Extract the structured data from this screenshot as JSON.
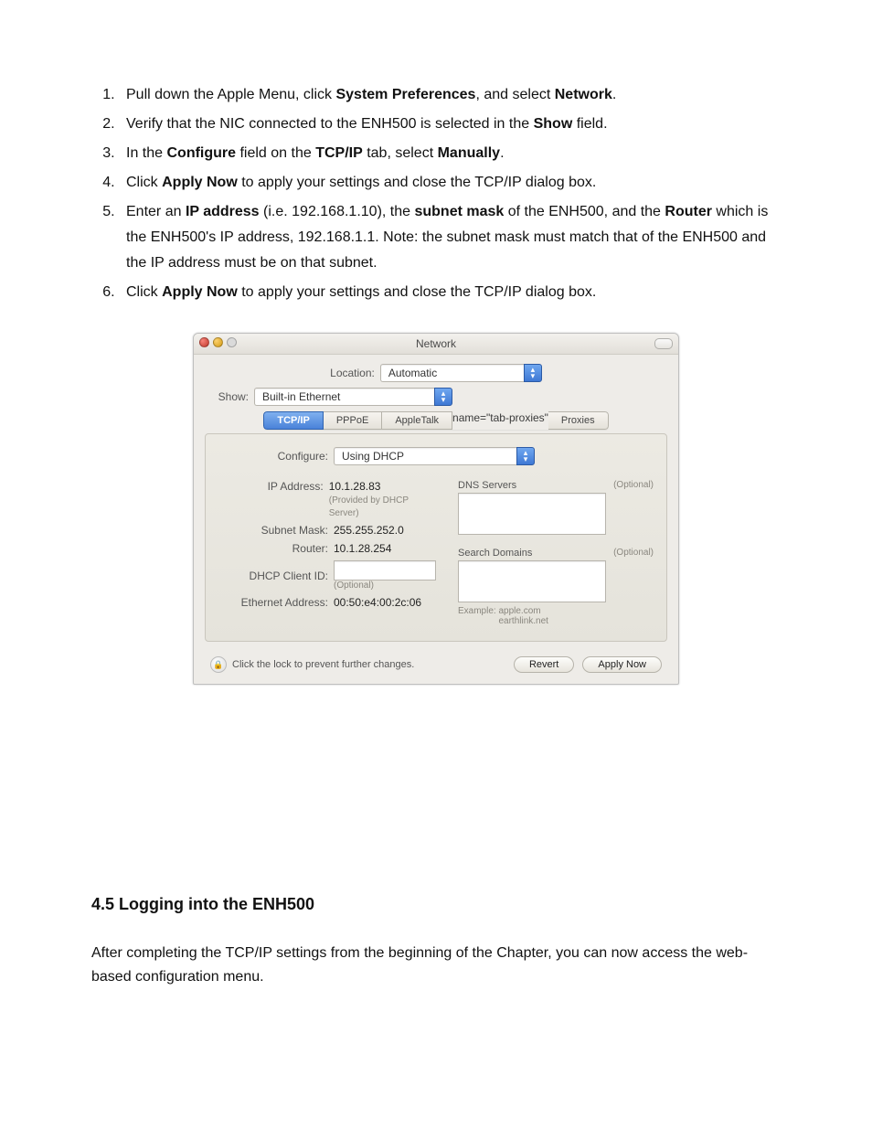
{
  "instructions": {
    "items": [
      {
        "pre": "Pull down the Apple Menu, click ",
        "b1": "System Preferences",
        "mid1": ", and select ",
        "b2": "Network",
        "post": "."
      },
      {
        "pre": "Verify that the NIC connected to the ENH500 is selected in the ",
        "b1": "Show",
        "post": " field."
      },
      {
        "pre": "In the ",
        "b1": "Configure",
        "mid1": " field on the ",
        "b2": "TCP/IP",
        "mid2": " tab, select ",
        "b3": "Manually",
        "post": "."
      },
      {
        "pre": "Click ",
        "b1": "Apply Now",
        "post": " to apply your settings and close the TCP/IP dialog box."
      },
      {
        "pre": "Enter an ",
        "b1": "IP address",
        "mid1": " (i.e. 192.168.1.10), the ",
        "b2": "subnet mask",
        "mid2": " of the ENH500, and the ",
        "b3": "Router",
        "post": " which is the ENH500's IP address, 192.168.1.1.   Note: the subnet mask must match that of the ENH500 and the IP address must be on that subnet."
      },
      {
        "pre": "Click ",
        "b1": "Apply Now",
        "post": " to apply your settings and close the TCP/IP dialog box."
      }
    ]
  },
  "window": {
    "title": "Network",
    "location_label": "Location:",
    "location_value": "Automatic",
    "show_label": "Show:",
    "show_value": "Built-in Ethernet",
    "tabs": {
      "tcpip": "TCP/IP",
      "pppoe": "PPPoE",
      "appletalk": "AppleTalk",
      "proxies": "Proxies"
    },
    "configure_label": "Configure:",
    "configure_value": "Using DHCP",
    "ip_label": "IP Address:",
    "ip_value": "10.1.28.83",
    "ip_sub": "(Provided by DHCP Server)",
    "mask_label": "Subnet Mask:",
    "mask_value": "255.255.252.0",
    "router_label": "Router:",
    "router_value": "10.1.28.254",
    "dhcp_label": "DHCP Client ID:",
    "dhcp_sub": "(Optional)",
    "eth_label": "Ethernet Address:",
    "eth_value": "00:50:e4:00:2c:06",
    "dns_label": "DNS Servers",
    "optional": "(Optional)",
    "search_label": "Search Domains",
    "example_label": "Example:",
    "example_line1": "apple.com",
    "example_line2": "earthlink.net",
    "lock_text": "Click the lock to prevent further changes.",
    "revert": "Revert",
    "apply_now": "Apply Now"
  },
  "section": {
    "title": "4.5 Logging into the ENH500",
    "body": "After completing the TCP/IP settings from the beginning of the Chapter, you can now access the web-based configuration menu."
  }
}
